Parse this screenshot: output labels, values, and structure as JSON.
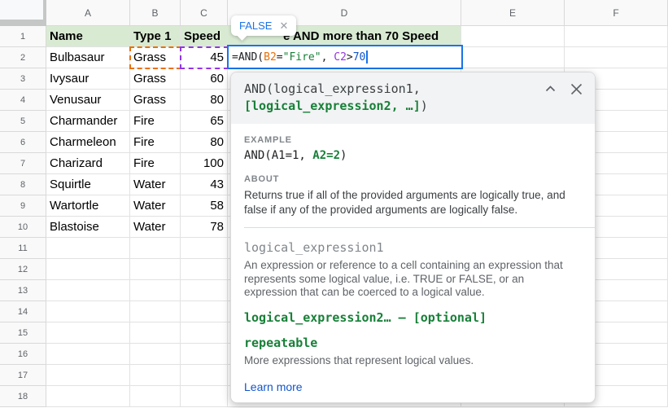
{
  "sheet": {
    "column_letters": [
      "A",
      "B",
      "C",
      "D",
      "E",
      "F"
    ],
    "row_count": 18,
    "header_row": {
      "name": "Name",
      "type": "Type 1",
      "speed": "Speed",
      "d1_visible_text": "e AND more than 70 Speed"
    },
    "data_rows": [
      {
        "name": "Bulbasaur",
        "type": "Grass",
        "speed": "45"
      },
      {
        "name": "Ivysaur",
        "type": "Grass",
        "speed": "60"
      },
      {
        "name": "Venusaur",
        "type": "Grass",
        "speed": "80"
      },
      {
        "name": "Charmander",
        "type": "Fire",
        "speed": "65"
      },
      {
        "name": "Charmeleon",
        "type": "Fire",
        "speed": "80"
      },
      {
        "name": "Charizard",
        "type": "Fire",
        "speed": "100"
      },
      {
        "name": "Squirtle",
        "type": "Water",
        "speed": "43"
      },
      {
        "name": "Wartortle",
        "type": "Water",
        "speed": "58"
      },
      {
        "name": "Blastoise",
        "type": "Water",
        "speed": "78"
      }
    ]
  },
  "formula": {
    "cell": "D2",
    "tokens": [
      {
        "text": "=AND(",
        "color": "#202124"
      },
      {
        "text": "B2",
        "color": "#e8710a"
      },
      {
        "text": "=",
        "color": "#202124"
      },
      {
        "text": "\"Fire\"",
        "color": "#188038"
      },
      {
        "text": ", ",
        "color": "#202124"
      },
      {
        "text": "C2",
        "color": "#9334e6"
      },
      {
        "text": ">",
        "color": "#202124"
      },
      {
        "text": "70",
        "color": "#1155cc"
      }
    ]
  },
  "result_chip": {
    "value": "FALSE",
    "close_glyph": "✕"
  },
  "help_popup": {
    "signature_line1": "AND(logical_expression1,",
    "signature_line2_highlight": "[logical_expression2, …]",
    "signature_close": ")",
    "example_label": "EXAMPLE",
    "example_prefix": "AND(A1=1, ",
    "example_highlight": "A2=2",
    "example_suffix": ")",
    "about_label": "ABOUT",
    "about_text": "Returns true if all of the provided arguments are logically true, and false if any of the provided arguments are logically false.",
    "param1_name": "logical_expression1",
    "param1_desc": "An expression or reference to a cell containing an expression that represents some logical value, i.e. TRUE or FALSE, or an expression that can be coerced to a logical value.",
    "param2_title": "logical_expression2… – [optional]",
    "repeatable_title": "repeatable",
    "repeatable_desc": "More expressions that represent logical values.",
    "learn_more_label": "Learn more"
  },
  "colors": {
    "header_row_green": "#d9ead3",
    "selected_cell_border": "#1a73e8",
    "ref1_orange": "#e8710a",
    "ref2_purple": "#9334e6",
    "string_green": "#188038",
    "number_blue": "#1155cc",
    "highlight_green": "#188038",
    "link_blue": "#1155cc",
    "chip_value_blue": "#1a73e8",
    "popup_header_gray": "#f1f3f4"
  }
}
